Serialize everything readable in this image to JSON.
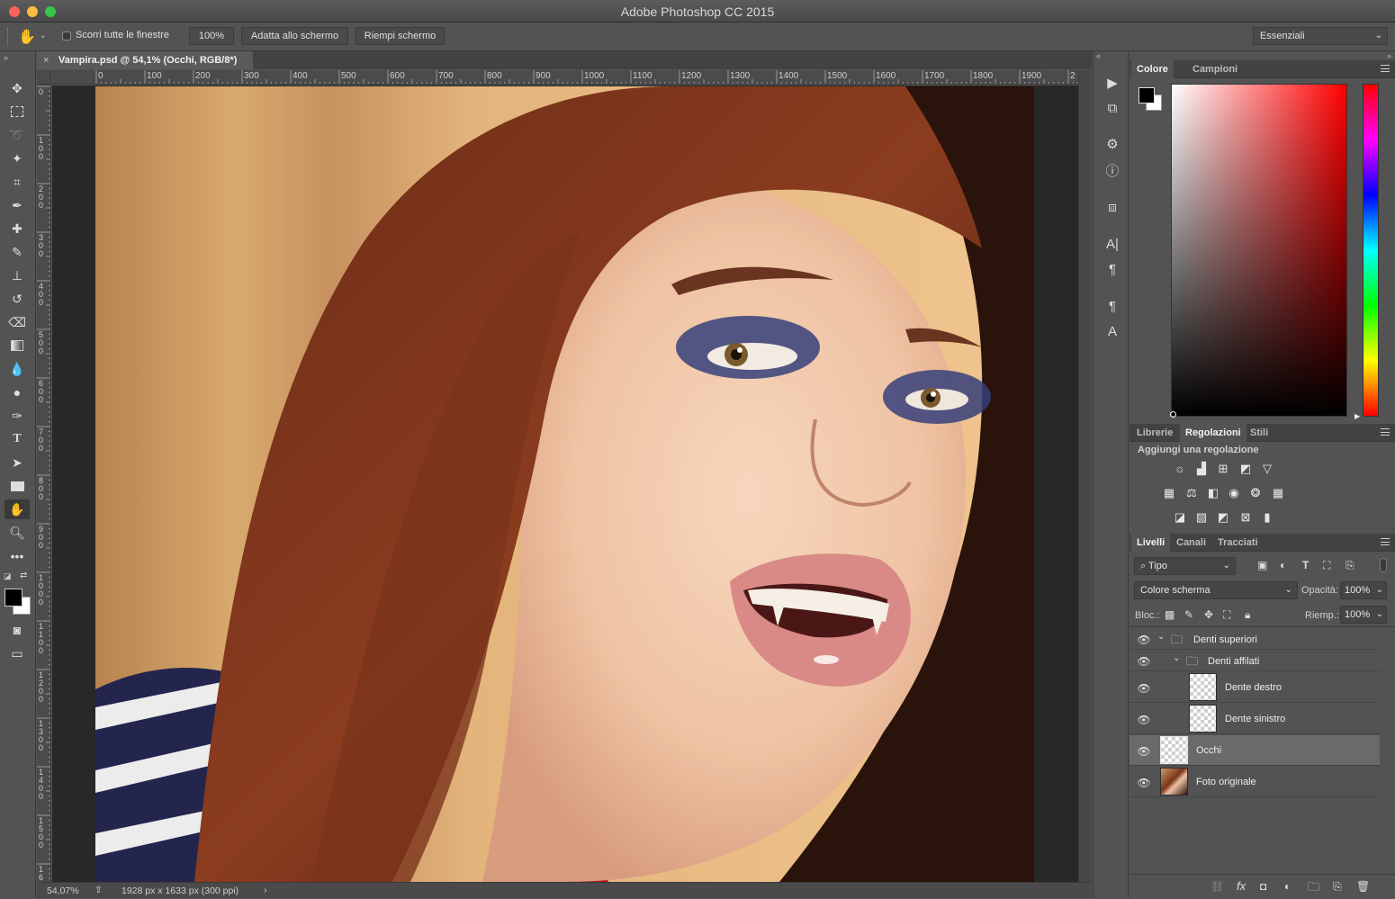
{
  "window": {
    "title": "Adobe Photoshop CC 2015"
  },
  "options_bar": {
    "scroll_all_label": "Scorri tutte le finestre",
    "zoom_100_label": "100%",
    "fit_screen_label": "Adatta allo schermo",
    "fill_screen_label": "Riempi schermo",
    "workspace": "Essenziali"
  },
  "document": {
    "tab_title": "Vampira.psd @ 54,1% (Occhi, RGB/8*)",
    "ruler_h": [
      "0",
      "100",
      "200",
      "300",
      "400",
      "500",
      "600",
      "700",
      "800",
      "900",
      "1000",
      "1100",
      "1200",
      "1300",
      "1400",
      "1500",
      "1600",
      "1700",
      "1800",
      "1900",
      "2"
    ],
    "ruler_v": [
      "0",
      "1\n0\n0",
      "2\n0\n0",
      "3\n0\n0",
      "4\n0\n0",
      "5\n0\n0",
      "6\n0\n0",
      "7\n0\n0",
      "8\n0\n0",
      "9\n0\n0",
      "1\n0\n0\n0",
      "1\n1\n0\n0",
      "1\n2\n0\n0",
      "1\n3\n0\n0",
      "1\n4\n0\n0",
      "1\n5\n0\n0",
      "1\n6"
    ],
    "zoom_status": "54,07%",
    "doc_info": "1928 px x 1633 px (300 ppi)"
  },
  "color_panel": {
    "tabs": [
      "Colore",
      "Campioni"
    ],
    "foreground": "#000000",
    "background": "#ffffff",
    "hue_color": "#ff0000"
  },
  "adjustments_panel": {
    "tabs": [
      "Librerie",
      "Regolazioni",
      "Stili"
    ],
    "heading": "Aggiungi una regolazione"
  },
  "layers_panel": {
    "tabs": [
      "Livelli",
      "Canali",
      "Tracciati"
    ],
    "filter_kind": "Tipo",
    "blend_mode": "Colore scherma",
    "opacity_label": "Opacità:",
    "opacity_value": "100%",
    "lock_label": "Bloc.:",
    "fill_label": "Riemp.:",
    "fill_value": "100%",
    "layers": [
      {
        "name": "Denti superiori",
        "type": "group"
      },
      {
        "name": "Denti affilati",
        "type": "group"
      },
      {
        "name": "Dente destro",
        "type": "layer"
      },
      {
        "name": "Dente sinistro",
        "type": "layer"
      },
      {
        "name": "Occhi",
        "type": "layer",
        "selected": true
      },
      {
        "name": "Foto originale",
        "type": "photo"
      }
    ]
  }
}
